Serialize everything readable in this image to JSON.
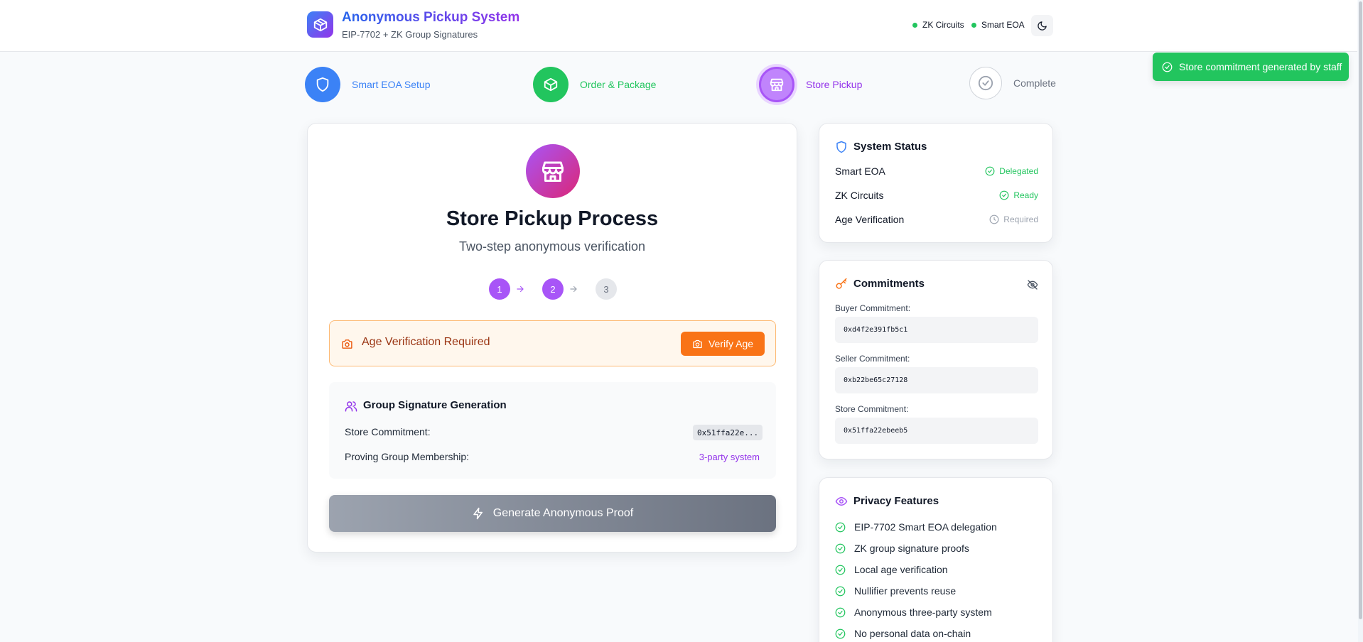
{
  "header": {
    "title": "Anonymous Pickup System",
    "subtitle": "EIP-7702 + ZK Group Signatures",
    "status": [
      "ZK Circuits",
      "Smart EOA"
    ],
    "logo_icon": "package-icon",
    "theme_icon": "moon-icon"
  },
  "toast": {
    "text": "Store commitment generated by staff"
  },
  "steps": [
    {
      "label": "Smart EOA Setup",
      "icon": "shield-icon",
      "color": "#3b82f6"
    },
    {
      "label": "Order & Package",
      "icon": "package-icon",
      "color": "#22c55e"
    },
    {
      "label": "Store Pickup",
      "icon": "store-icon",
      "color": "#a855f7"
    },
    {
      "label": "Complete",
      "icon": "check-circle-icon",
      "color": "#9ca3af"
    }
  ],
  "main": {
    "title": "Store Pickup Process",
    "subtitle": "Two-step anonymous verification",
    "mini_steps": [
      "1",
      "2",
      "3"
    ],
    "age_verification": {
      "label": "Age Verification Required",
      "button": "Verify Age"
    },
    "group_signature": {
      "title": "Group Signature Generation",
      "store_commitment_label": "Store Commitment:",
      "store_commitment_value": "0x51ffa22e...",
      "membership_label": "Proving Group Membership:",
      "membership_value": "3-party system"
    },
    "generate_button": "Generate Anonymous Proof"
  },
  "system_status": {
    "title": "System Status",
    "rows": [
      {
        "label": "Smart EOA",
        "value": "Delegated",
        "state": "ok"
      },
      {
        "label": "ZK Circuits",
        "value": "Ready",
        "state": "ok"
      },
      {
        "label": "Age Verification",
        "value": "Required",
        "state": "pending"
      }
    ]
  },
  "commitments": {
    "title": "Commitments",
    "items": [
      {
        "label": "Buyer Commitment:",
        "value": "0xd4f2e391fb5c1"
      },
      {
        "label": "Seller Commitment:",
        "value": "0xb22be65c27128"
      },
      {
        "label": "Store Commitment:",
        "value": "0x51ffa22ebeeb5"
      }
    ]
  },
  "privacy": {
    "title": "Privacy Features",
    "features": [
      "EIP-7702 Smart EOA delegation",
      "ZK group signature proofs",
      "Local age verification",
      "Nullifier prevents reuse",
      "Anonymous three-party system",
      "No personal data on-chain"
    ]
  },
  "colors": {
    "success": "#22c55e",
    "accent": "#a855f7",
    "warning": "#f97316",
    "primary": "#3b82f6"
  }
}
